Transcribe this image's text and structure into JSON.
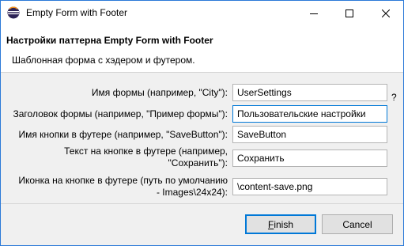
{
  "window": {
    "title": "Empty Form with Footer"
  },
  "header": {
    "title": "Настройки паттерна Empty Form with Footer",
    "description": "Шаблонная форма с хэдером и футером."
  },
  "form": {
    "help_mark": "?",
    "fields": [
      {
        "label_line1": "Имя формы (например, \"City\"):",
        "label_line2": "",
        "value": "UserSettings"
      },
      {
        "label_line1": "Заголовок формы (например, \"Пример формы\"):",
        "label_line2": "",
        "value": "Пользовательские настройки"
      },
      {
        "label_line1": "Имя кнопки в футере (например, \"SaveButton\"):",
        "label_line2": "",
        "value": "SaveButton"
      },
      {
        "label_line1": "Текст на кнопке в футере (например,",
        "label_line2": "\"Сохранить\"):",
        "value": "Сохранить"
      },
      {
        "label_line1": "Иконка на кнопке в футере (путь по умолчанию",
        "label_line2": "- Images\\24x24):",
        "value": "\\content-save.png"
      }
    ]
  },
  "footer": {
    "finish_mnemonic": "F",
    "finish_rest": "inish",
    "cancel_label": "Cancel"
  },
  "colors": {
    "accent": "#0078d7",
    "window_border": "#2b79d8"
  },
  "icons": [
    "eclipse-app-icon",
    "minimize-icon",
    "maximize-icon",
    "close-icon"
  ]
}
